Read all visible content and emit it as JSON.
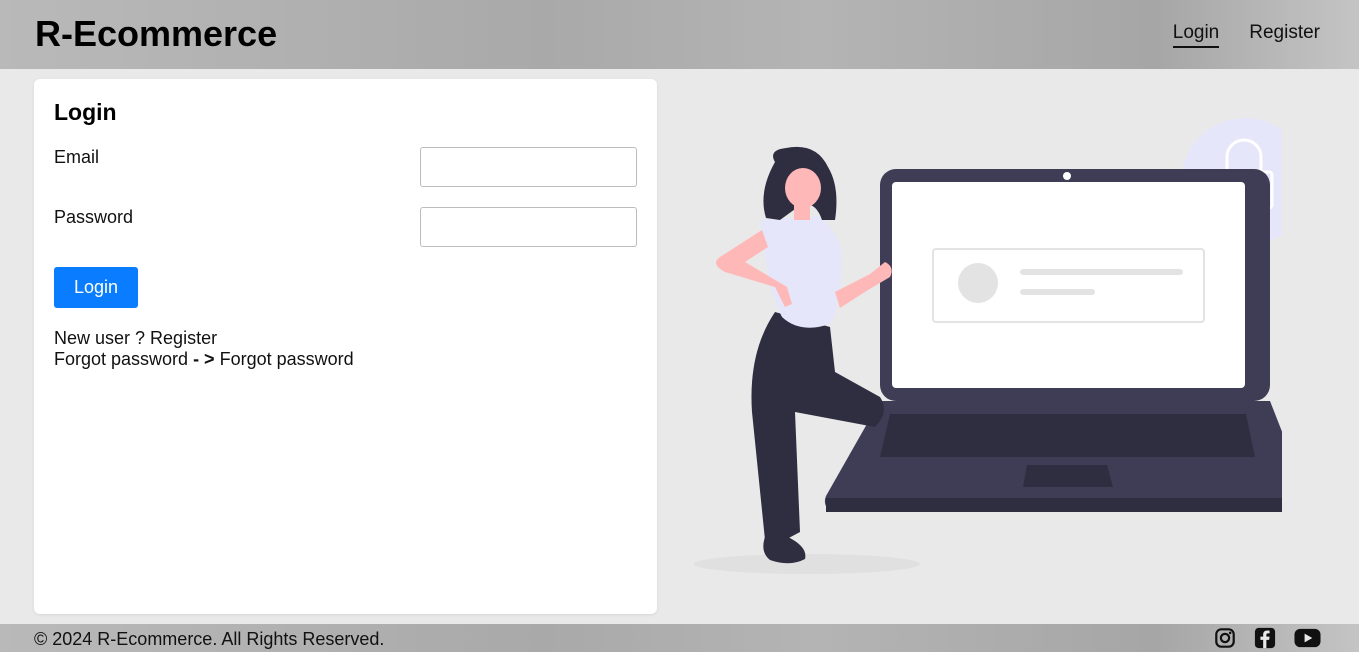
{
  "header": {
    "brand": "R-Ecommerce",
    "nav": [
      {
        "label": "Login",
        "active": true
      },
      {
        "label": "Register",
        "active": false
      }
    ]
  },
  "login_form": {
    "title": "Login",
    "email_label": "Email",
    "email_value": "",
    "email_placeholder": "",
    "password_label": "Password",
    "password_value": "",
    "password_placeholder": "",
    "submit_label": "Login",
    "new_user_text": "New user ? ",
    "register_link": "Register",
    "forgot_text": "Forgot password ",
    "forgot_arrow": "- >",
    "forgot_link": " Forgot password"
  },
  "illustration": {
    "icon": "woman-with-laptop-and-lock-illustration",
    "colors": {
      "laptop": "#3f3d56",
      "accent": "#e6e6fa",
      "skin": "#ffb8b8",
      "hair": "#2f2e41"
    }
  },
  "footer": {
    "copyright": "© 2024 R-Ecommerce. All Rights Reserved.",
    "social": [
      {
        "icon": "instagram-icon"
      },
      {
        "icon": "facebook-icon"
      },
      {
        "icon": "youtube-icon"
      }
    ]
  },
  "colors": {
    "primary_button": "#0a7cff",
    "page_bg": "#e9e9e9",
    "card_bg": "#ffffff"
  }
}
